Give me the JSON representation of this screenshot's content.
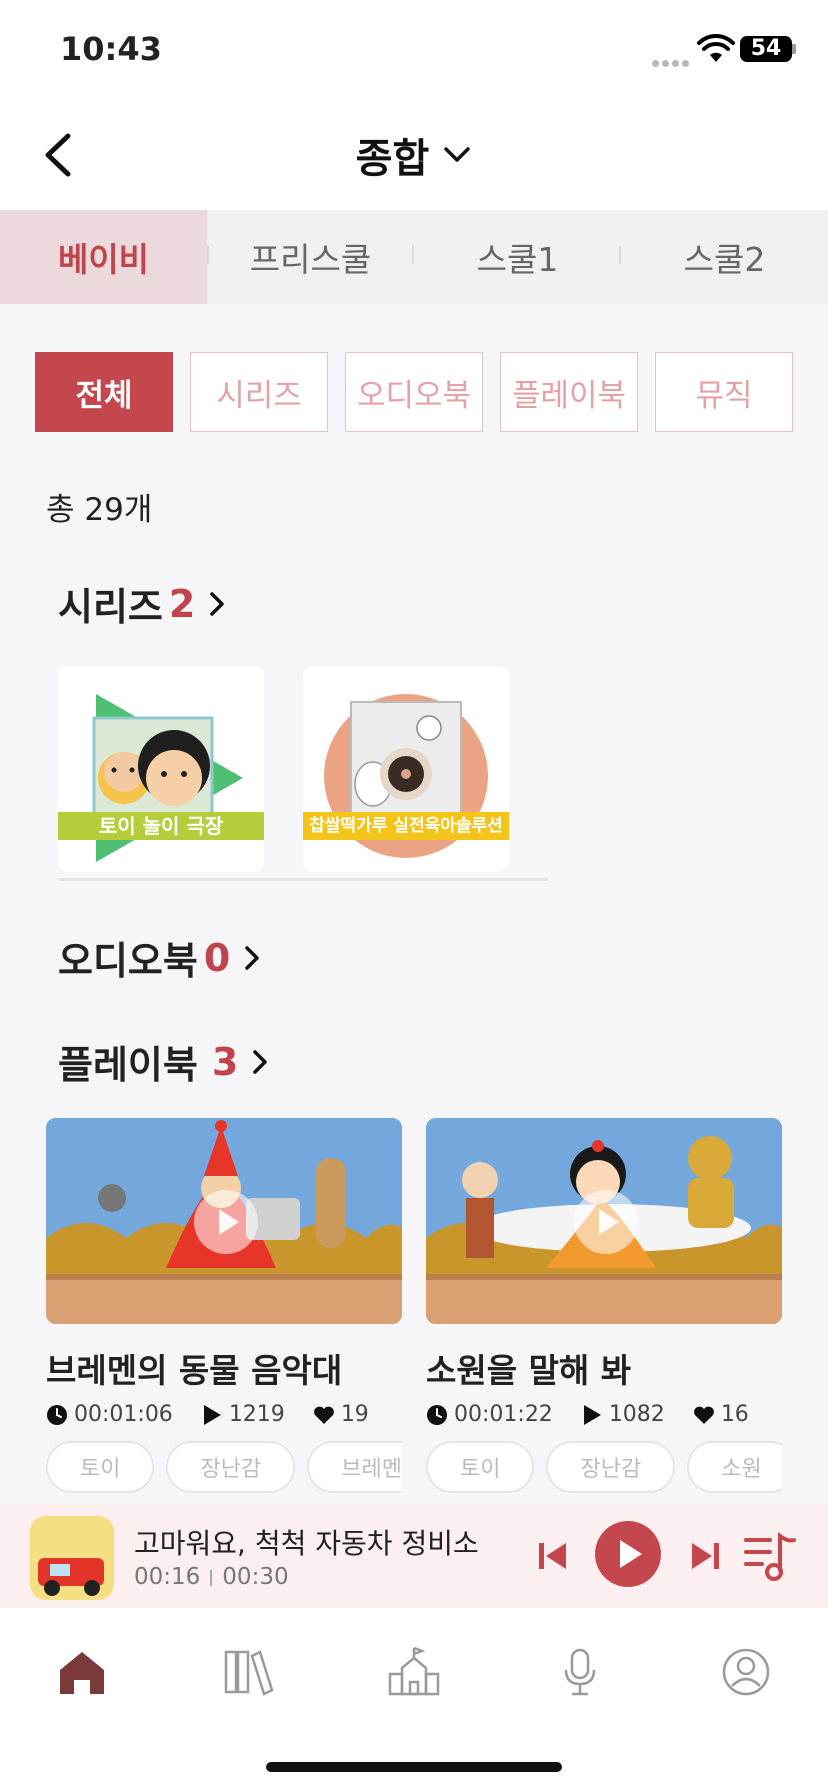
{
  "status": {
    "time": "10:43",
    "battery": "54"
  },
  "header": {
    "title": "종합"
  },
  "level_tabs": [
    {
      "label": "베이비",
      "active": true
    },
    {
      "label": "프리스쿨",
      "active": false
    },
    {
      "label": "스쿨1",
      "active": false
    },
    {
      "label": "스쿨2",
      "active": false
    }
  ],
  "filter_chips": [
    {
      "label": "전체",
      "active": true
    },
    {
      "label": "시리즈",
      "active": false
    },
    {
      "label": "오디오북",
      "active": false
    },
    {
      "label": "플레이북",
      "active": false
    },
    {
      "label": "뮤직",
      "active": false
    }
  ],
  "total_label": "총 29개",
  "sections": {
    "series": {
      "title": "시리즈",
      "count": "2"
    },
    "audiobook": {
      "title": "오디오북",
      "count": "0"
    },
    "playbook": {
      "title": "플레이북",
      "count": "3"
    }
  },
  "series_items": [
    {
      "banner": "토이 놀이 극장"
    },
    {
      "banner": "찹쌀떡가루 실전육아솔루션"
    }
  ],
  "playbooks": [
    {
      "title": "브레멘의 동물 음악대",
      "duration": "00:01:06",
      "plays": "1219",
      "likes": "19",
      "tags": [
        "토이",
        "장난감",
        "브레멘"
      ]
    },
    {
      "title": "소원을 말해 봐",
      "duration": "00:01:22",
      "plays": "1082",
      "likes": "16",
      "tags": [
        "토이",
        "장난감",
        "소원",
        ""
      ]
    }
  ],
  "player": {
    "title": "고마워요, 척척 자동차 정비소",
    "elapsed": "00:16",
    "total": "00:30",
    "art_text": "고마워요 척척 자동차 정비소"
  },
  "colors": {
    "accent": "#c4474e",
    "active_tab_bg": "#ecd9db",
    "player_bg": "#fcefef"
  },
  "tabbar": [
    "home-icon",
    "library-icon",
    "school-icon",
    "microphone-icon",
    "profile-icon"
  ]
}
